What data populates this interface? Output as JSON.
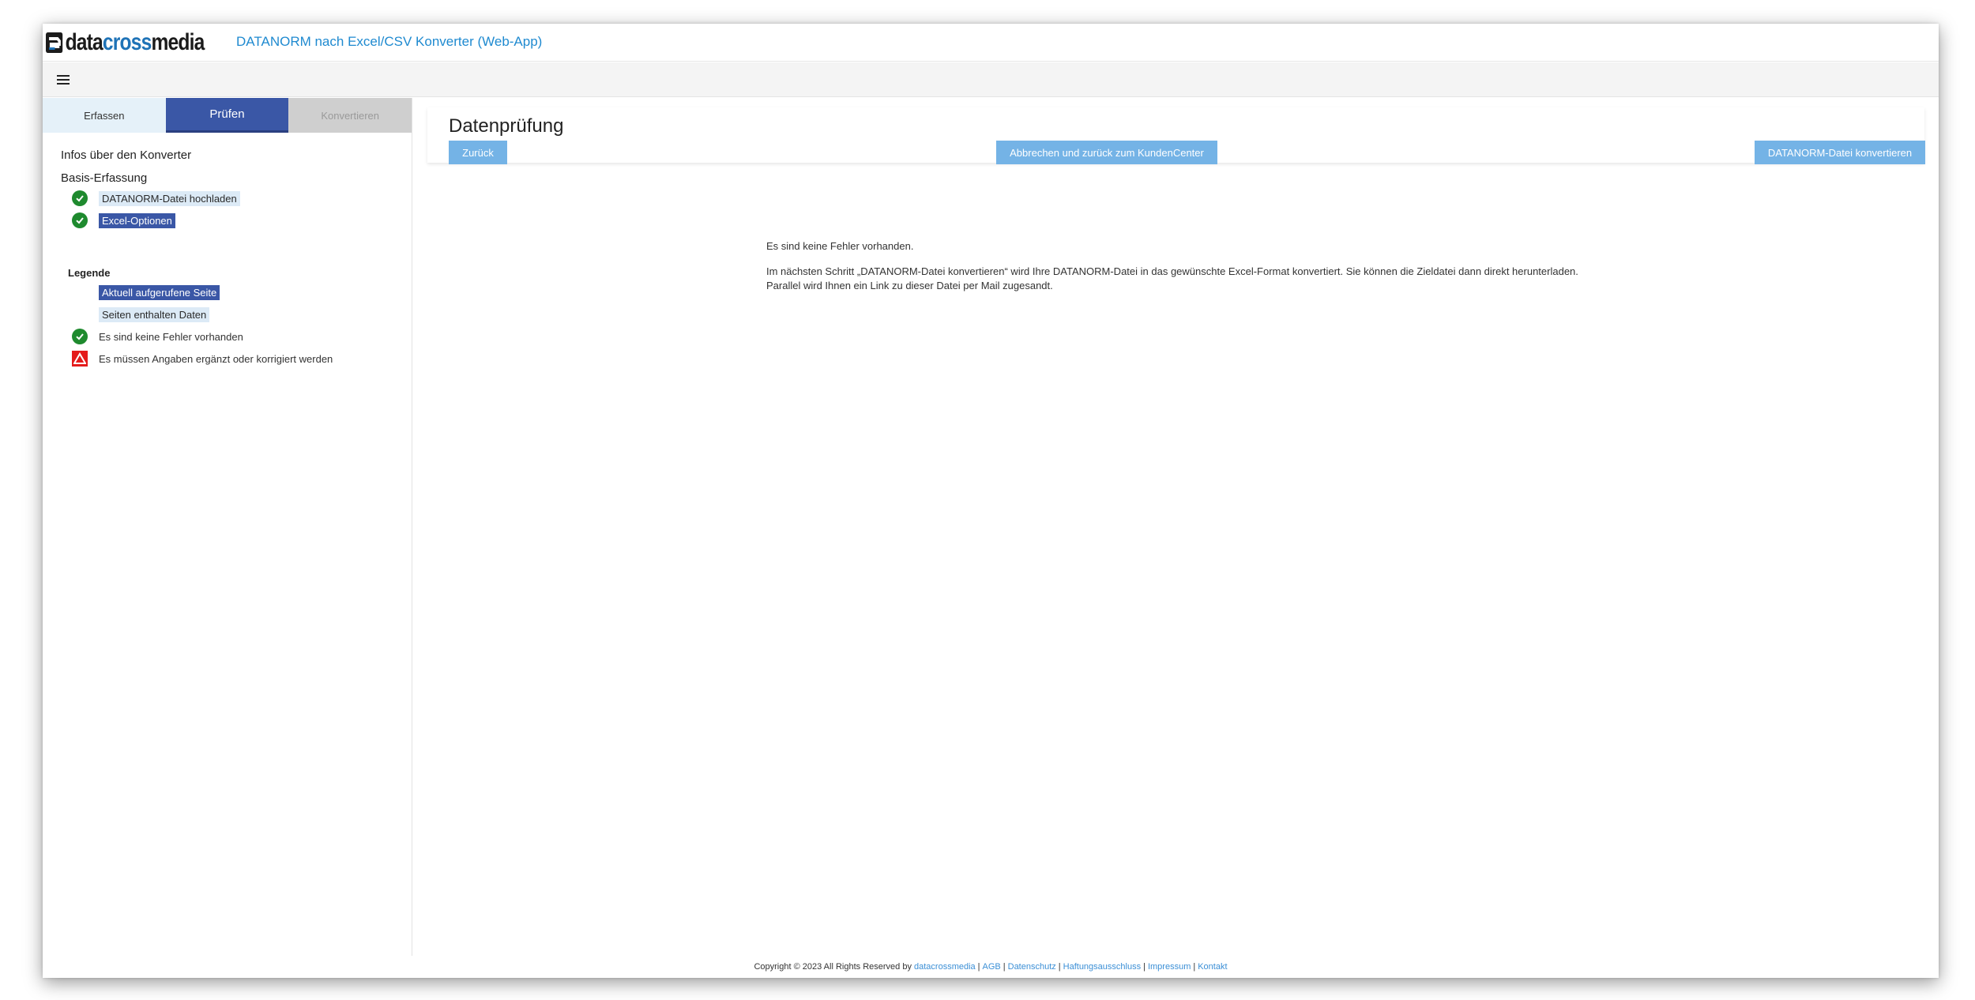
{
  "header": {
    "logo_part1": "data",
    "logo_part2": "cross",
    "logo_part3": "media",
    "app_title": "DATANORM nach Excel/CSV Konverter (Web-App)"
  },
  "sidebar": {
    "tabs": [
      {
        "label": "Erfassen"
      },
      {
        "label": "Prüfen"
      },
      {
        "label": "Konvertieren"
      }
    ],
    "info_title": "Infos über den Konverter",
    "basis_title": "Basis-Erfassung",
    "items": [
      {
        "label": "DATANORM-Datei hochladen"
      },
      {
        "label": "Excel-Optionen"
      }
    ],
    "legend": {
      "title": "Legende",
      "current_page": "Aktuell aufgerufene Seite",
      "pages_with_data": "Seiten enthalten Daten",
      "no_errors": "Es sind keine Fehler vorhanden",
      "needs_fix": "Es müssen Angaben ergänzt oder korrigiert werden"
    }
  },
  "main": {
    "title": "Datenprüfung",
    "back_label": "Zurück",
    "cancel_label": "Abbrechen und zurück zum KundenCenter",
    "convert_label": "DATANORM-Datei konvertieren",
    "message1": "Es sind keine Fehler vorhanden.",
    "message2": "Im nächsten Schritt „DATANORM-Datei konvertieren“ wird Ihre DATANORM-Datei in das gewünschte Excel-Format konvertiert. Sie können die Zieldatei dann direkt herunterladen.",
    "message3": "Parallel wird Ihnen ein Link zu dieser Datei per Mail zugesandt."
  },
  "footer": {
    "copyright": "Copyright © 2023 All Rights Reserved by",
    "links": [
      "datacrossmedia",
      "AGB",
      "Datenschutz",
      "Haftungsausschluss",
      "Impressum",
      "Kontakt"
    ]
  },
  "colors": {
    "accent": "#3a57a6",
    "button": "#74b3e6",
    "link": "#1f8ad0",
    "success": "#1e8a2e",
    "warning": "#e41b1b"
  },
  "icons": {
    "menu": "hamburger-icon",
    "ok": "check-circle-icon",
    "warn": "warning-triangle-icon"
  }
}
